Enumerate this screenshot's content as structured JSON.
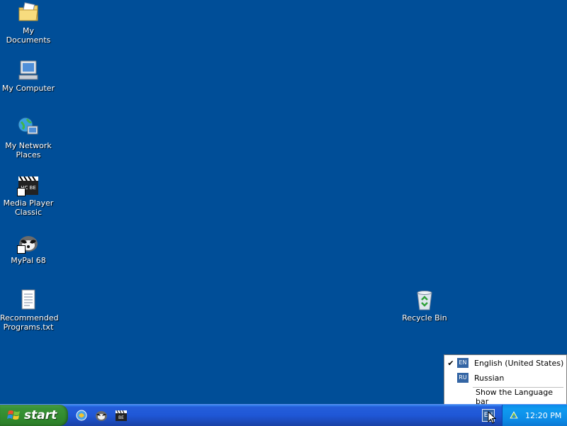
{
  "desktop": {
    "icons": [
      {
        "label": "My Documents",
        "icon": "my-documents-icon"
      },
      {
        "label": "My Computer",
        "icon": "my-computer-icon"
      },
      {
        "label": "My Network\nPlaces",
        "icon": "network-places-icon"
      },
      {
        "label": "Media Player\nClassic",
        "icon": "media-player-classic-icon"
      },
      {
        "label": "MyPal 68",
        "icon": "mypal-icon"
      },
      {
        "label": "Recommended\nPrograms.txt",
        "icon": "text-file-icon"
      },
      {
        "label": "Recycle Bin",
        "icon": "recycle-bin-icon"
      }
    ],
    "background_color": "#004e98"
  },
  "taskbar": {
    "start_label": "start",
    "quick_launch": [
      {
        "icon": "browser-icon"
      },
      {
        "icon": "mypal-icon"
      },
      {
        "icon": "media-player-icon"
      }
    ],
    "lang_indicator": "EN",
    "clock": "12:20 PM"
  },
  "lang_menu": {
    "items": [
      {
        "badge": "EN",
        "label": "English (United States)",
        "checked": true
      },
      {
        "badge": "RU",
        "label": "Russian",
        "checked": false
      }
    ],
    "show_bar_label": "Show the Language bar",
    "check_mark": "✔"
  }
}
